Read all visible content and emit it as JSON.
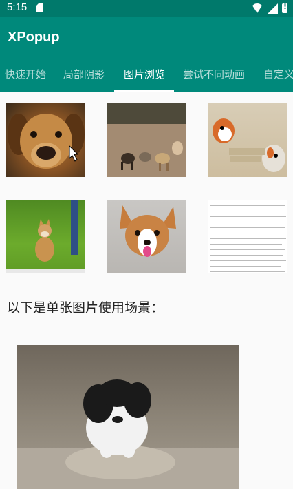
{
  "status_bar": {
    "time": "5:15"
  },
  "app_bar": {
    "title": "XPopup"
  },
  "tabs": [
    {
      "label": "快速开始",
      "active": false
    },
    {
      "label": "局部阴影",
      "active": false
    },
    {
      "label": "图片浏览",
      "active": true
    },
    {
      "label": "尝试不同动画",
      "active": false
    },
    {
      "label": "自定义",
      "active": false
    }
  ],
  "thumbnails": [
    {
      "subject": "golden-puppy-closeup"
    },
    {
      "subject": "dogs-on-walk"
    },
    {
      "subject": "cartoon-dogs"
    },
    {
      "subject": "shiba-on-grass"
    },
    {
      "subject": "corgi-puppy"
    },
    {
      "subject": "text-image"
    }
  ],
  "section_label": "以下是单张图片使用场景：",
  "single_image": {
    "subject": "black-white-puppy"
  },
  "colors": {
    "status_bar": "#00796b",
    "app_bar": "#00897b",
    "background": "#fafafa"
  }
}
